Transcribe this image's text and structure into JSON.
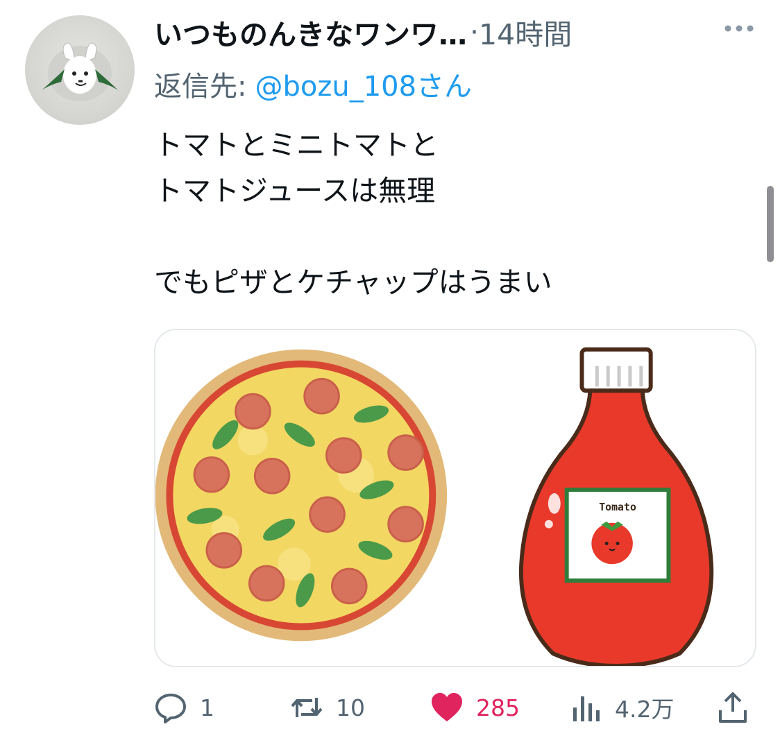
{
  "tweet": {
    "display_name": "いつものんきなワンワ…",
    "separator": "·",
    "time": "14時間",
    "reply_prefix": "返信先:",
    "reply_handle": "@bozu_108さん",
    "text_lines": [
      "トマトとミニトマトと",
      "トマトジュースは無理",
      "",
      "でもピザとケチャップはうまい"
    ],
    "media": {
      "label_text": "Tomato",
      "description_icons": [
        "pizza-illustration",
        "ketchup-bottle-illustration"
      ]
    },
    "actions": {
      "reply_count": "1",
      "retweet_count": "10",
      "like_count": "285",
      "views_count": "4.2万"
    }
  },
  "colors": {
    "text_primary": "#0f1419",
    "text_secondary": "#536471",
    "link": "#1d9bf0",
    "like": "#e0245e"
  },
  "icons": {
    "more": "more-dots-icon",
    "reply": "reply-bubble-icon",
    "retweet": "retweet-icon",
    "like": "heart-icon",
    "views": "analytics-bars-icon",
    "share": "share-upload-icon"
  }
}
